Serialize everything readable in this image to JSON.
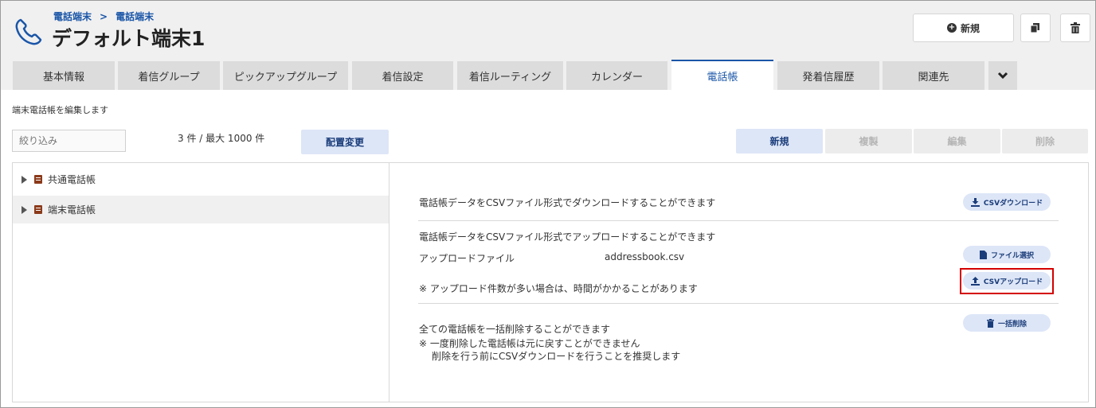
{
  "header": {
    "breadcrumb": [
      "電話端末",
      "電話端末"
    ],
    "breadcrumb_sep": ">",
    "title": "デフォルト端末1",
    "new_button": "新規",
    "icons": [
      "phone-icon",
      "plus-circle-icon",
      "copy-icon",
      "trash-icon"
    ]
  },
  "tabs": [
    {
      "label": "基本情報",
      "active": false
    },
    {
      "label": "着信グループ",
      "active": false
    },
    {
      "label": "ピックアップグループ",
      "active": false
    },
    {
      "label": "着信設定",
      "active": false
    },
    {
      "label": "着信ルーティング",
      "active": false
    },
    {
      "label": "カレンダー",
      "active": false
    },
    {
      "label": "電話帳",
      "active": true
    },
    {
      "label": "発着信履歴",
      "active": false
    },
    {
      "label": "関連先",
      "active": false
    }
  ],
  "toolbar": {
    "description": "端末電話帳を編集します",
    "filter_placeholder": "絞り込み",
    "count": "3 件 / 最大 1000 件",
    "reorder": "配置変更",
    "actions": {
      "new": "新規",
      "copy": "複製",
      "edit": "編集",
      "delete": "削除"
    }
  },
  "tree": [
    {
      "label": "共通電話帳",
      "selected": false
    },
    {
      "label": "端末電話帳",
      "selected": true
    }
  ],
  "detail": {
    "download_text": "電話帳データをCSVファイル形式でダウンロードすることができます",
    "download_button": "CSVダウンロード",
    "upload_text": "電話帳データをCSVファイル形式でアップロードすることができます",
    "upload_file_label": "アップロードファイル",
    "upload_file_name": "addressbook.csv",
    "select_file_button": "ファイル選択",
    "upload_note": "※ アップロード件数が多い場合は、時間がかかることがあります",
    "upload_button": "CSVアップロード",
    "bulk_delete_text": "全ての電話帳を一括削除することができます",
    "bulk_delete_note1": "※ 一度削除した電話帳は元に戻すことができません",
    "bulk_delete_note2": "削除を行う前にCSVダウンロードを行うことを推奨します",
    "bulk_delete_button": "一括削除"
  },
  "colors": {
    "accent": "#1a56a8",
    "highlight": "#d40000",
    "button_bg": "#dde6f7"
  }
}
